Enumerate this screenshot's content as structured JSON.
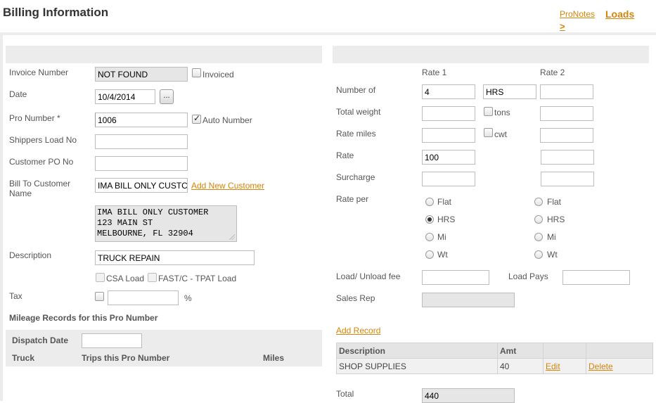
{
  "header": {
    "title": "Billing Information",
    "pronotes_link": "ProNotes",
    "loads_link": "Loads",
    "loads_arrow": ">"
  },
  "left": {
    "invoice_number": {
      "label": "Invoice Number",
      "value": "NOT FOUND",
      "invoiced_label": "Invoiced",
      "invoiced_checked": false
    },
    "date": {
      "label": "Date",
      "value": "10/4/2014",
      "picker_label": "..."
    },
    "pro_number": {
      "label": "Pro Number *",
      "value": "1006",
      "auto_label": "Auto Number",
      "auto_checked": true
    },
    "shippers_load_no": {
      "label": "Shippers Load No",
      "value": ""
    },
    "customer_po_no": {
      "label": "Customer PO No",
      "value": ""
    },
    "bill_to": {
      "label": "Bill To Customer Name",
      "value": "IMA BILL ONLY CUSTC",
      "add_link": "Add New Customer"
    },
    "address": "IMA BILL ONLY CUSTOMER\n123 MAIN ST\nMELBOURNE, FL 32904",
    "description": {
      "label": "Description",
      "value": "TRUCK REPAIN"
    },
    "csa_label": "CSA Load",
    "fast_label": "FAST/C - TPAT Load",
    "tax": {
      "label": "Tax",
      "value": "",
      "unit": "%"
    },
    "mileage": {
      "heading": "Mileage Records for this Pro Number",
      "dispatch_date_label": "Dispatch Date",
      "dispatch_date_value": "",
      "columns": [
        "Truck",
        "Trips this Pro Number",
        "Miles"
      ]
    }
  },
  "right": {
    "rate1_header": "Rate 1",
    "rate2_header": "Rate 2",
    "number_of": {
      "label": "Number of",
      "rate1": "4",
      "unit": "HRS",
      "rate2": ""
    },
    "total_weight": {
      "label": "Total weight",
      "rate1": "",
      "unit_label": "tons",
      "rate2": ""
    },
    "rate_miles": {
      "label": "Rate miles",
      "rate1": "",
      "unit_label": "cwt",
      "rate2": ""
    },
    "rate": {
      "label": "Rate",
      "rate1": "100",
      "rate2": ""
    },
    "surcharge": {
      "label": "Surcharge",
      "rate1": "",
      "rate2": ""
    },
    "rate_per": {
      "label": "Rate per",
      "options": [
        "Flat",
        "HRS",
        "Mi",
        "Wt"
      ],
      "rate1_selected": "HRS",
      "rate2_selected": ""
    },
    "load_unload_fee": {
      "label": "Load/ Unload fee",
      "value": ""
    },
    "load_pays": {
      "label": "Load Pays",
      "value": ""
    },
    "sales_rep": {
      "label": "Sales Rep",
      "value": ""
    },
    "add_record_link": "Add Record",
    "records": {
      "headers": [
        "Description",
        "Amt",
        "",
        ""
      ],
      "rows": [
        {
          "description": "SHOP SUPPLIES",
          "amt": "40",
          "edit": "Edit",
          "delete": "Delete"
        }
      ]
    },
    "total": {
      "label": "Total",
      "value": "440"
    }
  },
  "colors": {
    "accent_link": "#d4850a",
    "panel_bg": "#ececec"
  }
}
